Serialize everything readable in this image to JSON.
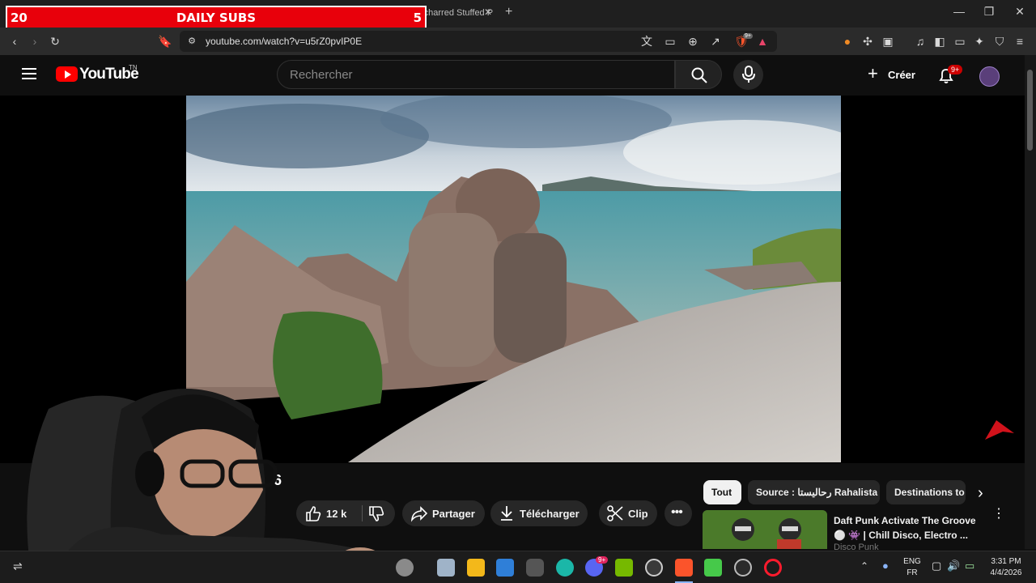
{
  "browser": {
    "tab_title": "rcharred Stuffed P",
    "url": "youtube.com/watch?v=u5rZ0pvIP0E",
    "ext_badge": "9+"
  },
  "overlay": {
    "left_number": "20",
    "title": "DAILY SUBS",
    "right_number": "5",
    "bg_color": "#e8000b"
  },
  "youtube": {
    "logo_word": "YouTube",
    "country_code": "TN",
    "search_placeholder": "Rechercher",
    "create_label": "Créer",
    "notifications_badge": "9+"
  },
  "video": {
    "title_fragment": "6",
    "likes": "12 k",
    "share_label": "Partager",
    "download_label": "Télécharger",
    "clip_label": "Clip"
  },
  "chips": [
    {
      "label": "Tout"
    },
    {
      "label": "Source : رحالیستا Rahalista"
    },
    {
      "label": "Destinations to"
    }
  ],
  "recommendation": {
    "title": "Daft Punk Activate The Groove ⚪ 👾 | Chill Disco, Electro ...",
    "channel": "Disco Punk"
  },
  "taskbar": {
    "discord_badge": "9+",
    "lang_top": "ENG",
    "lang_bottom": "FR",
    "time": "3:31 PM",
    "date": "4/4/2026"
  }
}
